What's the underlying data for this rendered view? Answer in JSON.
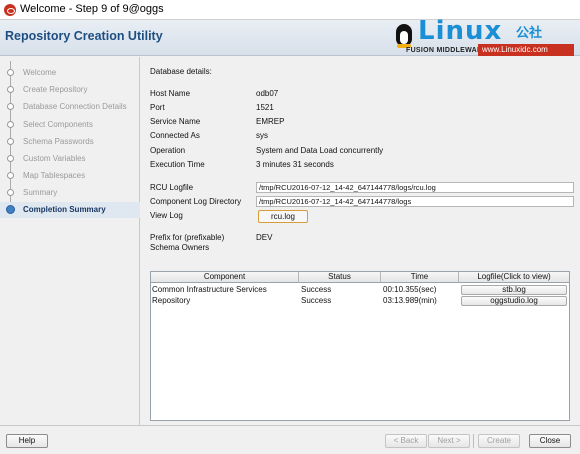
{
  "window": {
    "title": "Welcome - Step 9 of 9@oggs"
  },
  "header": {
    "app_title": "Repository Creation Utility",
    "brand_text": "Linux",
    "brand_suffix": "公社",
    "brand_product": "FUSION MIDDLEWARE",
    "watermark_url": "www.Linuxidc.com"
  },
  "sidebar": {
    "steps": [
      {
        "label": "Welcome"
      },
      {
        "label": "Create Repository"
      },
      {
        "label": "Database Connection Details"
      },
      {
        "label": "Select Components"
      },
      {
        "label": "Schema Passwords"
      },
      {
        "label": "Custom Variables"
      },
      {
        "label": "Map Tablespaces"
      },
      {
        "label": "Summary"
      },
      {
        "label": "Completion Summary"
      }
    ],
    "current_index": 8
  },
  "details": {
    "section_title": "Database details:",
    "host_label": "Host Name",
    "host_value": "odb07",
    "port_label": "Port",
    "port_value": "1521",
    "service_label": "Service Name",
    "service_value": "EMREP",
    "connected_label": "Connected As",
    "connected_value": "sys",
    "operation_label": "Operation",
    "operation_value": "System and Data Load concurrently",
    "exec_label": "Execution Time",
    "exec_value": "3  minutes 31  seconds",
    "rcu_log_label": "RCU Logfile",
    "rcu_log_value": "/tmp/RCU2016-07-12_14-42_647144778/logs/rcu.log",
    "comp_dir_label": "Component Log Directory",
    "comp_dir_value": "/tmp/RCU2016-07-12_14-42_647144778/logs",
    "view_log_label": "View Log",
    "view_log_button": "rcu.log",
    "prefix_label_1": "Prefix for (prefixable)",
    "prefix_label_2": "Schema Owners",
    "prefix_value": "DEV"
  },
  "components_table": {
    "headers": {
      "component": "Component",
      "status": "Status",
      "time": "Time",
      "logfile": "Logfile(Click to view)"
    },
    "rows": [
      {
        "component": "Common Infrastructure Services",
        "status": "Success",
        "time": "00:10.355(sec)",
        "logfile": "stb.log"
      },
      {
        "component": "Repository",
        "status": "Success",
        "time": "03:13.989(min)",
        "logfile": "oggstudio.log"
      }
    ]
  },
  "footer": {
    "help": "Help",
    "back": "< Back",
    "next": "Next >",
    "create": "Create",
    "close": "Close"
  }
}
